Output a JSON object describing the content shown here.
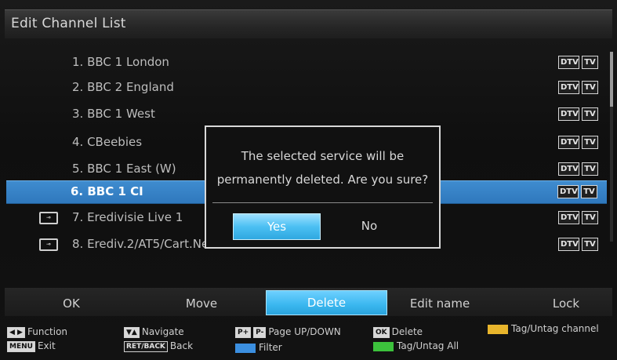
{
  "header": {
    "title": "Edit Channel List"
  },
  "channels": [
    {
      "label": "1. BBC 1 London",
      "locked": false,
      "selected": false,
      "dtv": "DTV",
      "tv": "TV"
    },
    {
      "label": "2. BBC 2 England",
      "locked": false,
      "selected": false,
      "dtv": "DTV",
      "tv": "TV"
    },
    {
      "label": "3. BBC 1 West",
      "locked": false,
      "selected": false,
      "dtv": "DTV",
      "tv": "TV"
    },
    {
      "label": "4. CBeebies",
      "locked": false,
      "selected": false,
      "dtv": "DTV",
      "tv": "TV"
    },
    {
      "label": "5. BBC 1 East (W)",
      "locked": false,
      "selected": false,
      "dtv": "DTV",
      "tv": "TV"
    },
    {
      "label": "6. BBC 1 CI",
      "locked": false,
      "selected": true,
      "dtv": "DTV",
      "tv": "TV"
    },
    {
      "label": "7. Eredivisie Live 1",
      "locked": true,
      "selected": false,
      "dtv": "DTV",
      "tv": "TV"
    },
    {
      "label": "8. Erediv.2/AT5/Cart.Ne",
      "locked": true,
      "selected": false,
      "dtv": "DTV",
      "tv": "TV"
    }
  ],
  "dialog": {
    "message_line1": "The selected service will be",
    "message_line2": "permanently deleted. Are you sure?",
    "yes_label": "Yes",
    "no_label": "No"
  },
  "function_bar": {
    "items": [
      "OK",
      "Move",
      "Delete",
      "Edit name",
      "Lock"
    ],
    "active": "Delete"
  },
  "help": {
    "function_key": "◀ ▶",
    "function_label": "Function",
    "menu_key": "MENU",
    "exit_label": "Exit",
    "navigate_key": "▼▲",
    "navigate_label": "Navigate",
    "return_key": "RET/BACK",
    "back_label": "Back",
    "page_key_plus": "P+",
    "page_key_minus": "P-",
    "page_label": "Page UP/DOWN",
    "filter_label": "Filter",
    "ok_key": "OK",
    "delete_label": "Delete",
    "tag_all_label": "Tag/Untag All",
    "tag_channel_label": "Tag/Untag channel"
  },
  "colors": {
    "selection": "#3a86c9",
    "accent_button": "#3ab7ef",
    "yellow_key": "#e8b52c",
    "green_key": "#3cc13c",
    "blue_key": "#3b8fe0"
  },
  "icons": {
    "lock": "lock-icon",
    "dtv": "dtv-badge",
    "tv": "tv-badge"
  }
}
